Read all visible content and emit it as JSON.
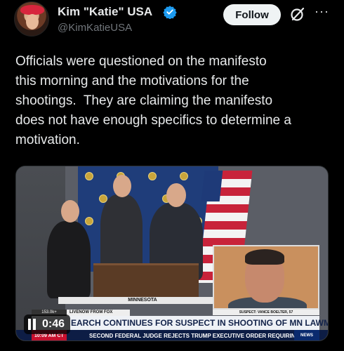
{
  "author": {
    "display_name": "Kim \"Katie\" USA",
    "handle": "@KimKatieUSA",
    "verified_color": "#1d9bf0"
  },
  "actions": {
    "follow_label": "Follow",
    "grok_icon": "grok-icon",
    "more_icon": "more-icon"
  },
  "tweet": {
    "text": "Officials were questioned on the manifesto\nthis morning and the motivations for the\nshootings.  They are claiming the manifesto\ndoes not have enough specifics to determine a\nmotivation."
  },
  "video": {
    "location_label": "MINNESOTA",
    "suspect_label": "SUSPECT: VANCE BOELTER, 57",
    "views": "153.0k+",
    "live_label": "LIVENOW FROM FOX",
    "headline": "EARCH CONTINUES FOR SUSPECT IN SHOOTING OF MN LAWMAKERS",
    "time": "10:09 AM CT",
    "crawl": "SECOND FEDERAL JUDGE REJECTS TRUMP EXECUTIVE ORDER REQUIRING",
    "news_badge": "NEWS",
    "duration": "0:46",
    "colors": {
      "ticker_red": "#c8102e",
      "ticker_navy": "#0d1d45"
    }
  }
}
